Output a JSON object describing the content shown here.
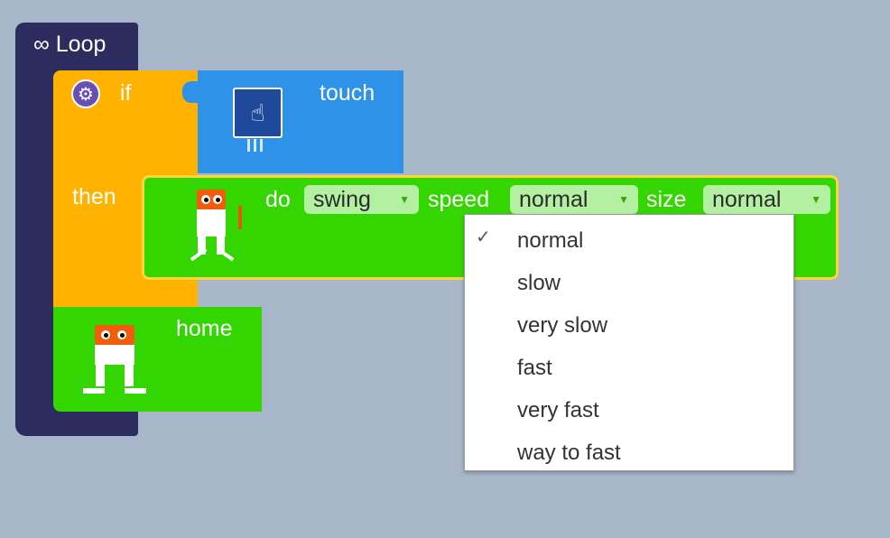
{
  "loop": {
    "symbol": "∞",
    "label": "Loop"
  },
  "if_block": {
    "label": "if",
    "then_label": "then",
    "gear_icon": "gear-icon",
    "color": "#ffb300"
  },
  "touch_block": {
    "label": "touch",
    "icon": "touch-hand-icon",
    "color": "#2e93e8"
  },
  "do_block": {
    "do_label": "do",
    "action_value": "swing",
    "speed_label": "speed",
    "speed_value": "normal",
    "size_label": "size",
    "size_value": "normal",
    "color": "#33d600"
  },
  "home_block": {
    "label": "home"
  },
  "speed_menu": {
    "selected": "normal",
    "options": [
      "normal",
      "slow",
      "very slow",
      "fast",
      "very fast",
      "way to fast"
    ]
  },
  "colors": {
    "workspace": "#a7b6c8",
    "loop": "#2c2c5e",
    "highlight": "#ffd43b"
  }
}
